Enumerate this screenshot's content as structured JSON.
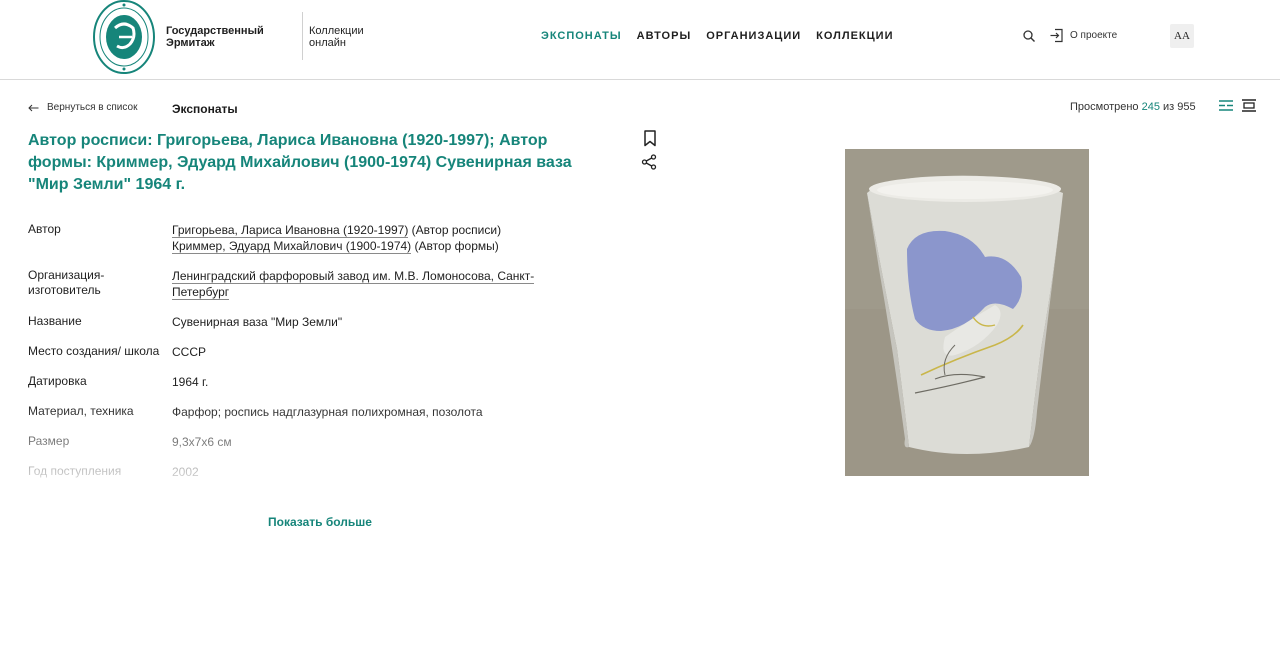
{
  "header": {
    "logo_line1": "Государственный",
    "logo_line2": "Эрмитаж",
    "collections_line1": "Коллекции",
    "collections_line2": "онлайн",
    "nav": [
      "ЭКСПОНАТЫ",
      "АВТОРЫ",
      "ОРГАНИЗАЦИИ",
      "КОЛЛЕКЦИИ"
    ],
    "about_label": "О проекте",
    "font_toggle": "AA"
  },
  "breadcrumb": {
    "back_label": "Вернуться в список",
    "section": "Экспонаты"
  },
  "viewed": {
    "prefix": "Просмотрено",
    "current": "245",
    "middle": "из",
    "total": "955"
  },
  "title": "Автор росписи: Григорьева, Лариса Ивановна (1920-1997); Автор формы: Криммер, Эдуард Михайлович (1900-1974) Сувенирная ваза \"Мир Земли\" 1964 г.",
  "details": {
    "author": {
      "label": "Автор",
      "name1": "Григорьева, Лариса Ивановна (1920-1997)",
      "role1": " (Автор росписи)",
      "name2": "Криммер, Эдуард Михайлович (1900-1974)",
      "role2": " (Автор формы)"
    },
    "organization": {
      "label": "Организация-изготовитель",
      "value": "Ленинградский фарфоровый завод им. М.В. Ломоносова, Санкт-Петербург"
    },
    "name": {
      "label": "Название",
      "value": "Сувенирная ваза \"Мир Земли\""
    },
    "place": {
      "label": "Место создания/ школа",
      "value": "СССР"
    },
    "date": {
      "label": "Датировка",
      "value": "1964 г."
    },
    "material": {
      "label": "Материал, техника",
      "value": "Фарфор; роспись надглазурная полихромная, позолота"
    },
    "size": {
      "label": "Размер",
      "value": "9,3x7x6 см"
    },
    "acquired": {
      "label": "Год поступления",
      "value": "2002"
    }
  },
  "show_more": "Показать больше",
  "colors": {
    "accent": "#16857a",
    "text": "#1f1f1f",
    "divider": "#d9d9d9"
  },
  "icons": {
    "search": "search-icon",
    "about": "login-arrow-icon",
    "bookmark": "bookmark-icon",
    "share": "share-icon",
    "back": "arrow-left-icon",
    "view_list": "list-view-icon",
    "view_compact": "compact-view-icon"
  }
}
